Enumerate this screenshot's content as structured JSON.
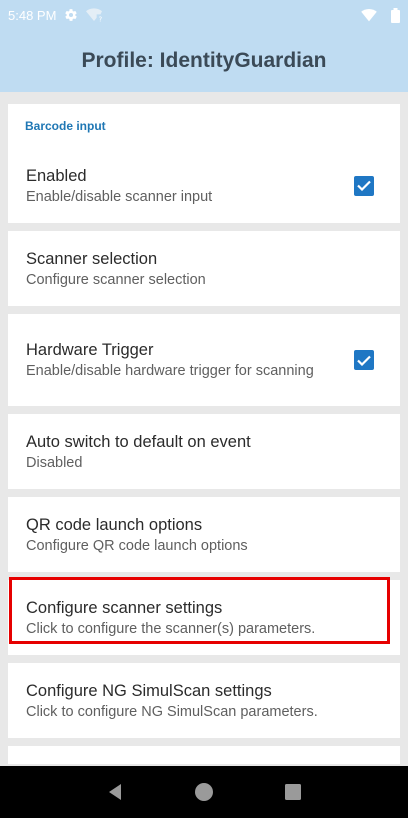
{
  "status_bar": {
    "time": "5:48 PM",
    "icons": [
      "gear-icon",
      "wifi-question-icon",
      "wifi-icon",
      "battery-icon"
    ]
  },
  "app_bar": {
    "title": "Profile: IdentityGuardian"
  },
  "section": {
    "header": "Barcode input"
  },
  "preferences": [
    {
      "title": "Enabled",
      "summary": "Enable/disable scanner input",
      "checked": true
    },
    {
      "title": "Scanner selection",
      "summary": "Configure scanner selection"
    },
    {
      "title": "Hardware Trigger",
      "summary": "Enable/disable hardware trigger for scanning",
      "checked": true
    },
    {
      "title": "Auto switch to default on event",
      "summary": "Disabled"
    },
    {
      "title": "QR code launch options",
      "summary": "Configure QR code launch options"
    },
    {
      "title": "Configure scanner settings",
      "summary": "Click to configure the scanner(s) parameters.",
      "highlighted": true
    },
    {
      "title": "Configure NG SimulScan settings",
      "summary": "Click to configure NG SimulScan parameters."
    }
  ],
  "nav_bar": {
    "icons": [
      "back-icon",
      "home-icon",
      "recents-icon"
    ]
  },
  "colors": {
    "app_bar": "#bfdcf2",
    "accent": "#1f77c4",
    "highlight": "#e60000"
  }
}
